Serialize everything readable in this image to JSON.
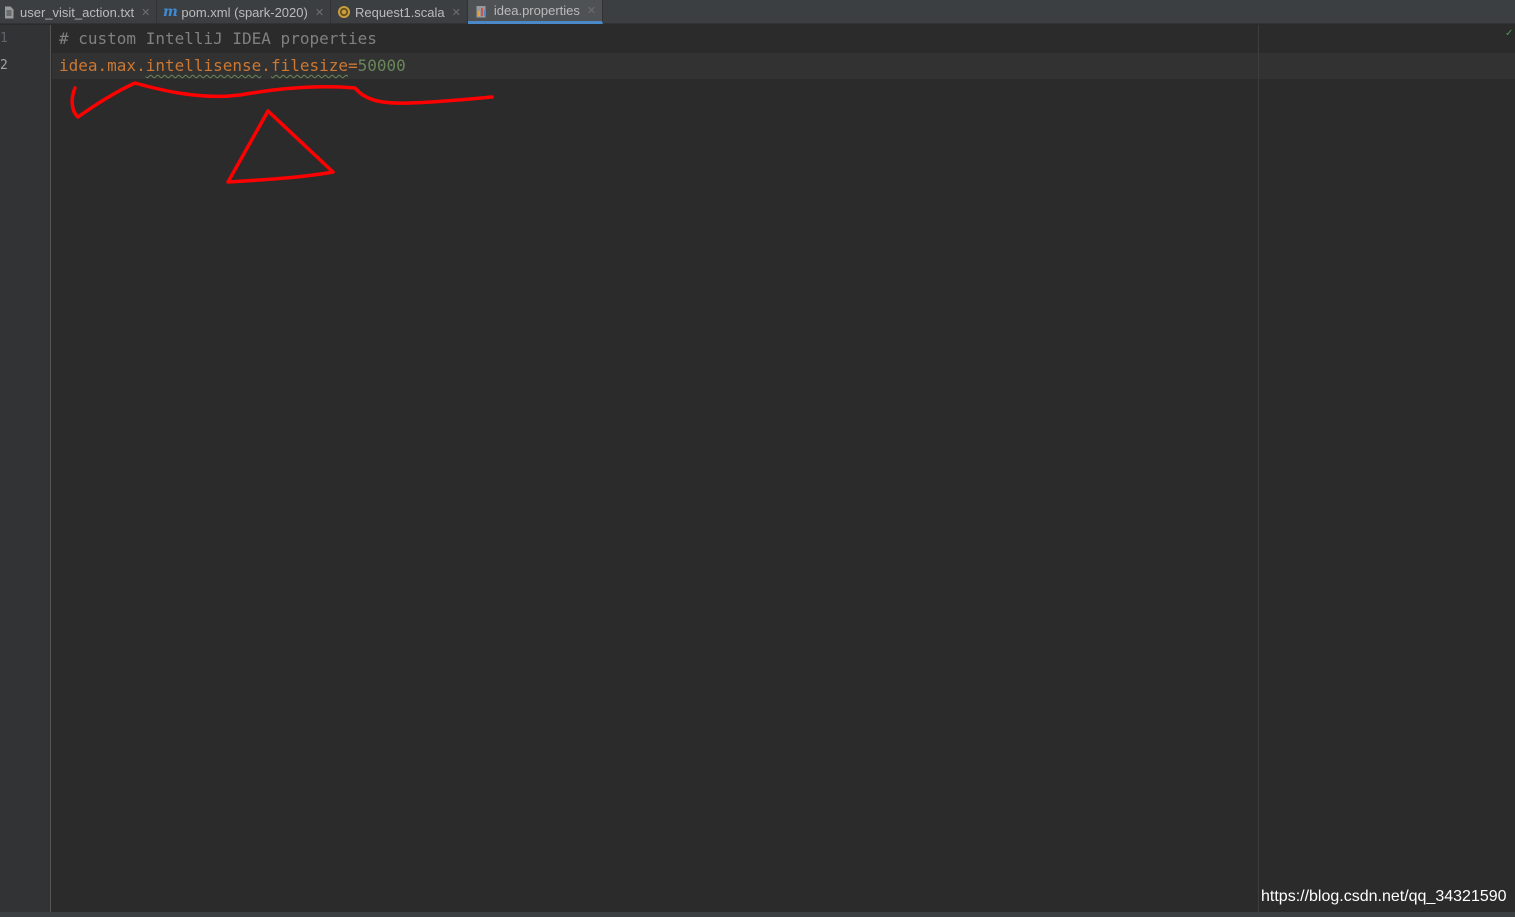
{
  "tabs": [
    {
      "label": "user_visit_action.txt",
      "icon": "text-file-icon",
      "active": false
    },
    {
      "label": "pom.xml (spark-2020)",
      "icon": "maven-m-icon",
      "active": false
    },
    {
      "label": "Request1.scala",
      "icon": "scala-object-icon",
      "active": false
    },
    {
      "label": "idea.properties",
      "icon": "properties-file-icon",
      "active": true
    }
  ],
  "tab_close_glyph": "✕",
  "gutter": {
    "line_numbers": [
      "1",
      "2"
    ]
  },
  "code": {
    "line1_comment": "# custom IntelliJ IDEA properties",
    "line2": {
      "key_part1": "idea.max.",
      "key_part2": "intellisense",
      "key_part3": ".",
      "key_part4": "filesize",
      "equals": "=",
      "value": "50000"
    }
  },
  "inspection_status_icon": "check-icon",
  "watermark": "https://blog.csdn.net/qq_34321590",
  "colors": {
    "accent_tab_underline": "#4a88c7",
    "annotation": "#ff0000",
    "key": "#cc7832",
    "value": "#6a8759",
    "comment": "#808080"
  }
}
